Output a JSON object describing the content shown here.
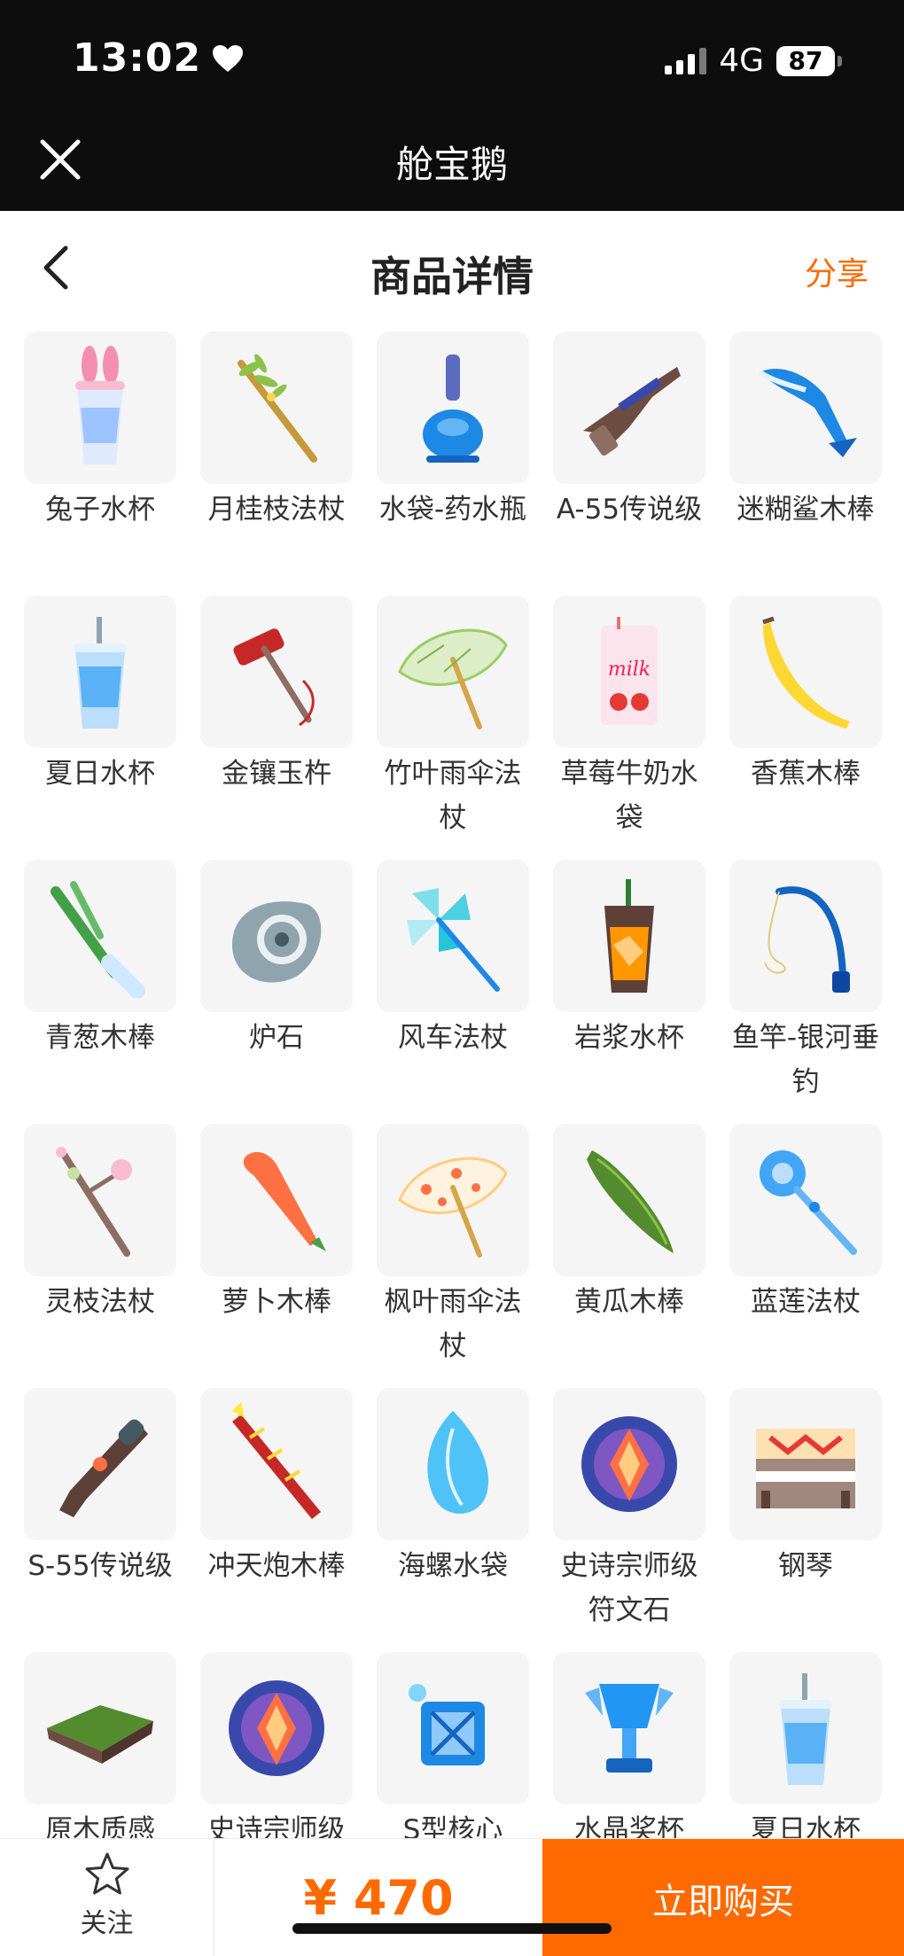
{
  "status": {
    "time": "13:02",
    "network": "4G",
    "battery": "87"
  },
  "app": {
    "title": "舱宝鹅"
  },
  "header": {
    "title": "商品详情",
    "share": "分享"
  },
  "items": [
    {
      "name": "兔子水杯",
      "icon": "bunny-cup-icon"
    },
    {
      "name": "月桂枝法杖",
      "icon": "laurel-staff-icon"
    },
    {
      "name": "水袋-药水瓶",
      "icon": "potion-bottle-icon"
    },
    {
      "name": "A-55传说级",
      "icon": "rifle-icon"
    },
    {
      "name": "迷糊鲨木棒",
      "icon": "shark-bat-icon"
    },
    {
      "name": "夏日水杯",
      "icon": "summer-cup-icon"
    },
    {
      "name": "金镶玉杵",
      "icon": "mallet-icon"
    },
    {
      "name": "竹叶雨伞法杖",
      "icon": "bamboo-umbrella-icon"
    },
    {
      "name": "草莓牛奶水袋",
      "icon": "milk-bag-icon"
    },
    {
      "name": "香蕉木棒",
      "icon": "banana-icon"
    },
    {
      "name": "青葱木棒",
      "icon": "scallion-icon"
    },
    {
      "name": "炉石",
      "icon": "hearthstone-icon"
    },
    {
      "name": "风车法杖",
      "icon": "pinwheel-icon"
    },
    {
      "name": "岩浆水杯",
      "icon": "lava-cup-icon"
    },
    {
      "name": "鱼竿-银河垂钓",
      "icon": "fishing-rod-icon"
    },
    {
      "name": "灵枝法杖",
      "icon": "blossom-branch-icon"
    },
    {
      "name": "萝卜木棒",
      "icon": "carrot-icon"
    },
    {
      "name": "枫叶雨伞法杖",
      "icon": "maple-umbrella-icon"
    },
    {
      "name": "黄瓜木棒",
      "icon": "cucumber-icon"
    },
    {
      "name": "蓝莲法杖",
      "icon": "blue-lotus-staff-icon"
    },
    {
      "name": "S-55传说级",
      "icon": "blunderbuss-icon"
    },
    {
      "name": "冲天炮木棒",
      "icon": "firework-rocket-icon"
    },
    {
      "name": "海螺水袋",
      "icon": "conch-icon"
    },
    {
      "name": "史诗宗师级符文石",
      "icon": "rune-stone-icon"
    },
    {
      "name": "钢琴",
      "icon": "piano-icon"
    },
    {
      "name": "原木质感",
      "icon": "grass-block-icon"
    },
    {
      "name": "史诗宗师级",
      "icon": "rune-stone-icon"
    },
    {
      "name": "S型核心",
      "icon": "core-cube-icon"
    },
    {
      "name": "水晶奖杯",
      "icon": "crystal-trophy-icon"
    },
    {
      "name": "夏日水杯",
      "icon": "summer-cup-icon"
    }
  ],
  "footer": {
    "follow": "关注",
    "price": "¥ 470",
    "buy": "立即购买"
  }
}
